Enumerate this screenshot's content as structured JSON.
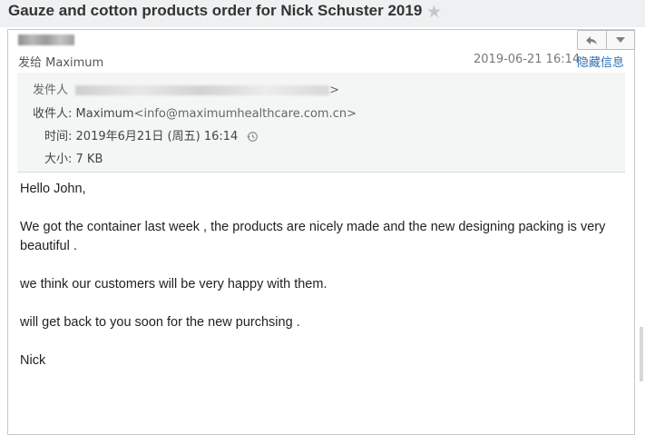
{
  "email": {
    "subject": "Gauze and cotton products order for Nick Schuster 2019",
    "to_prefix": "发给",
    "to_name": "Maximum",
    "datetime": "2019-06-21 16:14",
    "hide_details_label": "隐藏信息",
    "details": {
      "from_label": "发件人",
      "to_label": "收件人:",
      "to_value": "Maximum",
      "to_email": "<info@maximumhealthcare.com.cn>",
      "time_label": "时间:",
      "time_value": "2019年6月21日 (周五) 16:14",
      "size_label": "大小:",
      "size_value": "7 KB"
    },
    "body": [
      "Hello John,",
      "We got the container last week , the products are nicely made and the new designing packing is very beautiful .",
      "we think our customers will be very happy with them.",
      "will get back to you soon for the new purchsing .",
      "Nick"
    ]
  },
  "icons": {
    "star": "star-icon",
    "reply": "reply-icon",
    "dropdown": "chevron-down-icon",
    "clock": "clock-history-icon"
  }
}
